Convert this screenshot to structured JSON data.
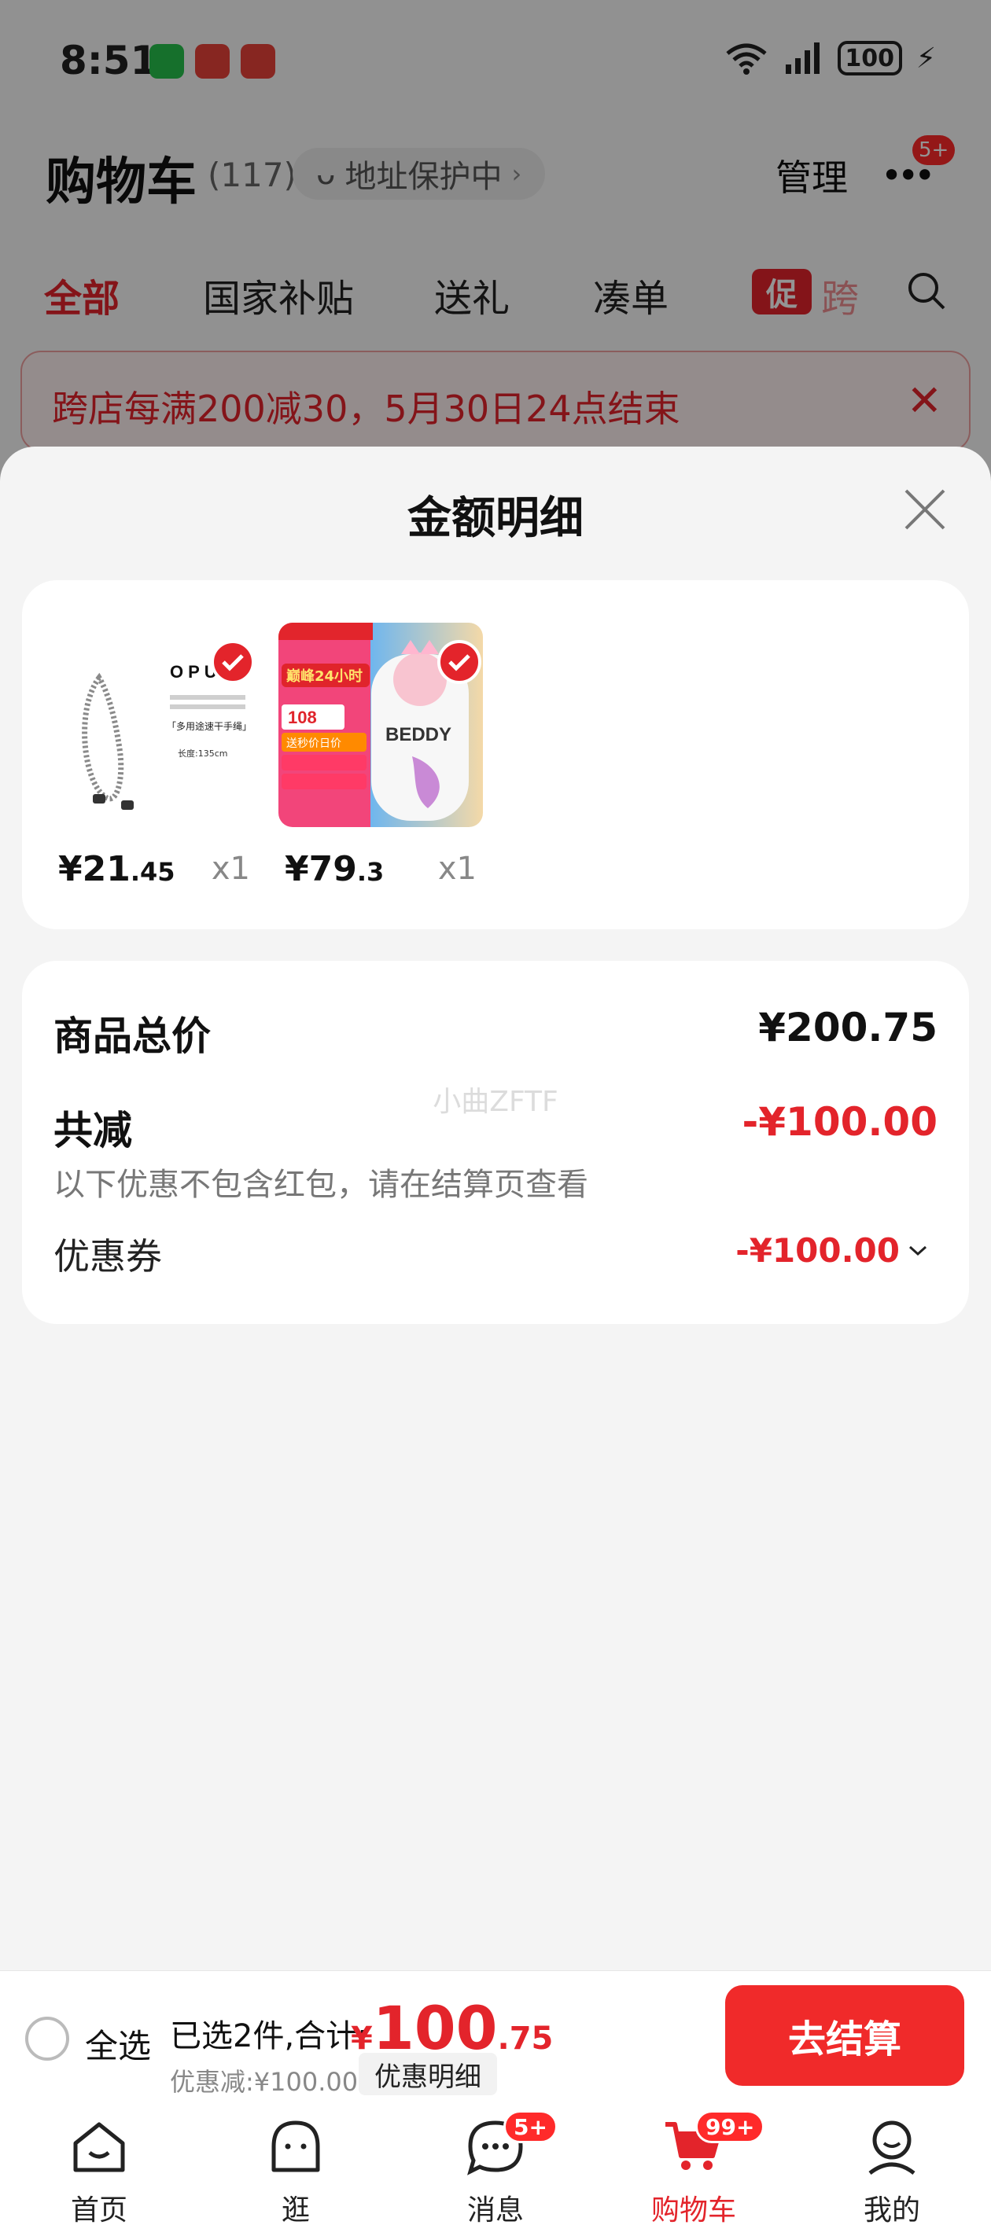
{
  "status_bar": {
    "time": "8:51",
    "battery": "100",
    "network": "6"
  },
  "header": {
    "title": "购物车",
    "count": "(117)",
    "address_protect": "地址保护中",
    "manage": "管理",
    "more_badge": "5+"
  },
  "tabs": [
    "全部",
    "国家补贴",
    "送礼",
    "凑单"
  ],
  "promo_tab": {
    "badge": "促",
    "label": "跨"
  },
  "promo_banner": {
    "text": "跨店每满200减30，5月30日24点结束"
  },
  "sheet": {
    "title": "金额明细",
    "products": [
      {
        "price_int": "¥21",
        "price_dec": ".45",
        "qty": "x1",
        "brand_text": "OPU",
        "caption": "「多用途速干手绳」",
        "length": "长度:135cm"
      },
      {
        "price_int": "¥79",
        "price_dec": ".3",
        "qty": "x1",
        "brand_text": "BEDDY",
        "promo_line": "巅峰24小时",
        "promo_price": "108",
        "promo_sub": "送秒价日价"
      }
    ],
    "summary": {
      "goods_total_label": "商品总价",
      "goods_total_value": "¥200.75",
      "watermark": "小曲ZFTF",
      "reduction_label": "共减",
      "reduction_value": "-¥100.00",
      "reduction_note": "以下优惠不包含红包，请在结算页查看",
      "coupon_label": "优惠券",
      "coupon_value": "-¥100.00"
    }
  },
  "checkout": {
    "select_all": "全选",
    "selected_text": "已选2件,合计:",
    "total_currency": "¥",
    "total_int": "100",
    "total_dec": ".75",
    "discount_text": "优惠减:¥100.00",
    "detail_label": "优惠明细",
    "button": "去结算"
  },
  "tabbar": [
    {
      "label": "首页",
      "icon": "home-icon"
    },
    {
      "label": "逛",
      "icon": "browse-icon"
    },
    {
      "label": "消息",
      "icon": "message-icon",
      "badge": "5+"
    },
    {
      "label": "购物车",
      "icon": "cart-icon",
      "badge": "99+",
      "active": true
    },
    {
      "label": "我的",
      "icon": "profile-icon"
    }
  ],
  "colors": {
    "accent": "#e3242b",
    "button": "#f02a2a",
    "sheet_bg": "#f4f4f4"
  }
}
